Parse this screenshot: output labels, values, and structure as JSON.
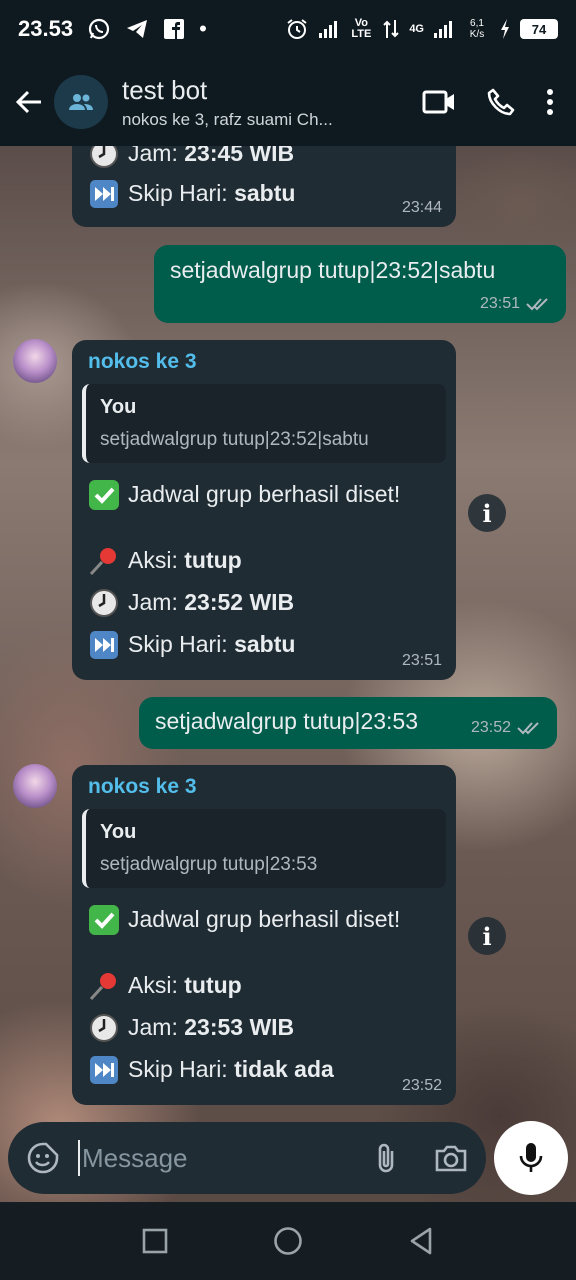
{
  "status_bar": {
    "time": "23.53",
    "network": "Vo LTE",
    "signal_4g": "4G",
    "speed": "6,1 K/s",
    "battery": "74"
  },
  "header": {
    "title": "test bot",
    "subtitle": "nokos ke 3, rafz suami Ch..."
  },
  "messages": [
    {
      "partial_line_1": "Jam: ",
      "partial_line_1_bold": "23:45 WIB",
      "line_skip_label": "Skip Hari: ",
      "line_skip_value": "sabtu",
      "time": "23:44"
    },
    {
      "text": "setjadwalgrup tutup|23:52|sabtu",
      "time": "23:51"
    },
    {
      "sender": "nokos ke 3",
      "quote_author": "You",
      "quote_text": "setjadwalgrup tutup|23:52|sabtu",
      "success": "Jadwal grup berhasil diset!",
      "action_label": "Aksi: ",
      "action_value": "tutup",
      "jam_label": "Jam: ",
      "jam_value": "23:52 WIB",
      "skip_label": "Skip Hari: ",
      "skip_value": "sabtu",
      "time": "23:51"
    },
    {
      "text": "setjadwalgrup tutup|23:53",
      "time": "23:52"
    },
    {
      "sender": "nokos ke 3",
      "quote_author": "You",
      "quote_text": "setjadwalgrup tutup|23:53",
      "success": "Jadwal grup berhasil diset!",
      "action_label": "Aksi: ",
      "action_value": "tutup",
      "jam_label": "Jam: ",
      "jam_value": "23:53 WIB",
      "skip_label": "Skip Hari: ",
      "skip_value": "tidak ada",
      "time": "23:52"
    }
  ],
  "composer": {
    "placeholder": "Message"
  },
  "colors": {
    "incoming_bubble": "#202c33",
    "outgoing_bubble": "#005c4b",
    "sender_name": "#53bdeb",
    "header_bg": "#0f1a20"
  }
}
